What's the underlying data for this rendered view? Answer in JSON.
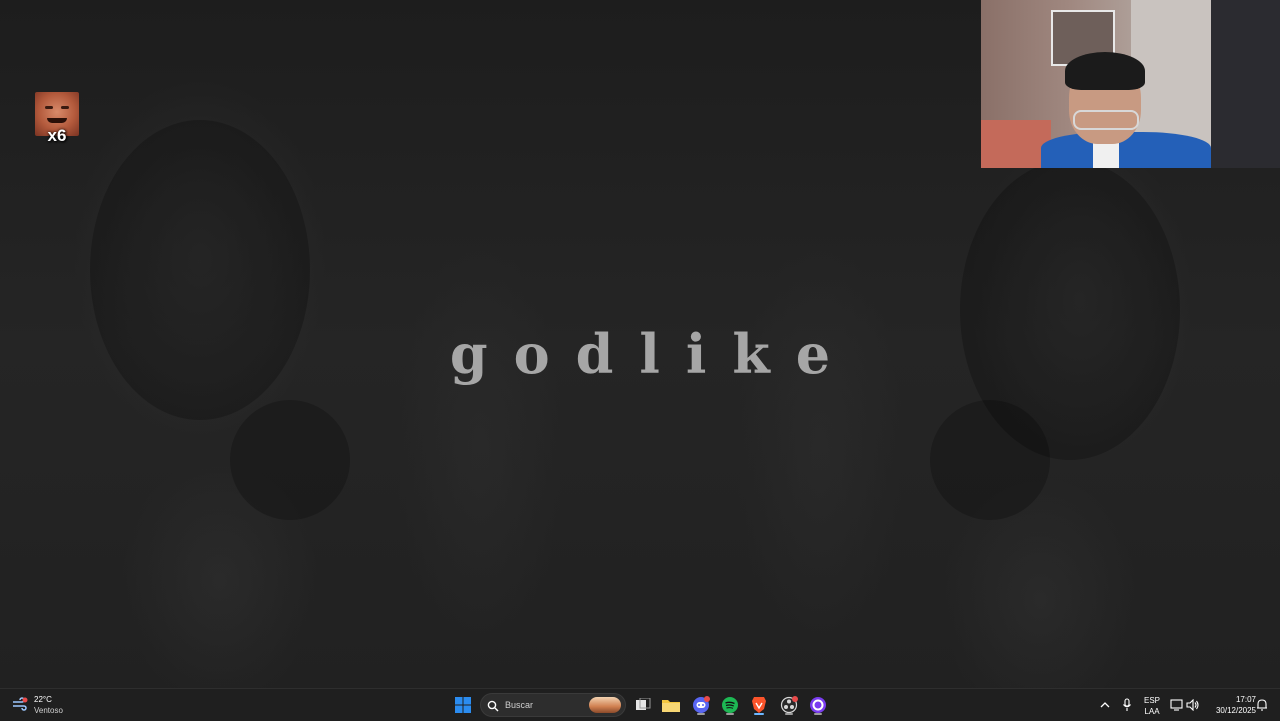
{
  "wallpaper": {
    "title": "godlike"
  },
  "stream_overlay": {
    "emote_count": "x6"
  },
  "taskbar": {
    "weather": {
      "temperature": "22°C",
      "condition": "Ventoso",
      "icon": "wind-weather-icon"
    },
    "search": {
      "label": "Buscar",
      "icon": "search-icon"
    },
    "apps": [
      {
        "name": "start",
        "icon": "windows-logo-icon"
      },
      {
        "name": "task-view",
        "icon": "task-view-icon"
      },
      {
        "name": "file-explorer",
        "icon": "folder-icon"
      },
      {
        "name": "discord",
        "icon": "discord-icon"
      },
      {
        "name": "spotify",
        "icon": "spotify-icon"
      },
      {
        "name": "brave",
        "icon": "brave-lion-icon"
      },
      {
        "name": "obs",
        "icon": "obs-icon"
      },
      {
        "name": "browser",
        "icon": "circle-app-icon"
      }
    ],
    "tray": {
      "language_top": "ESP",
      "language_bottom": "LAA",
      "time": "17:07",
      "date": "30/12/2025"
    }
  },
  "colors": {
    "taskbar_bg": "#1f1f1f",
    "active_indicator": "#6cb6ff",
    "spotify": "#1db954",
    "discord": "#5865f2",
    "brave": "#fb542b",
    "windows_blue": "#2b8cf0"
  }
}
